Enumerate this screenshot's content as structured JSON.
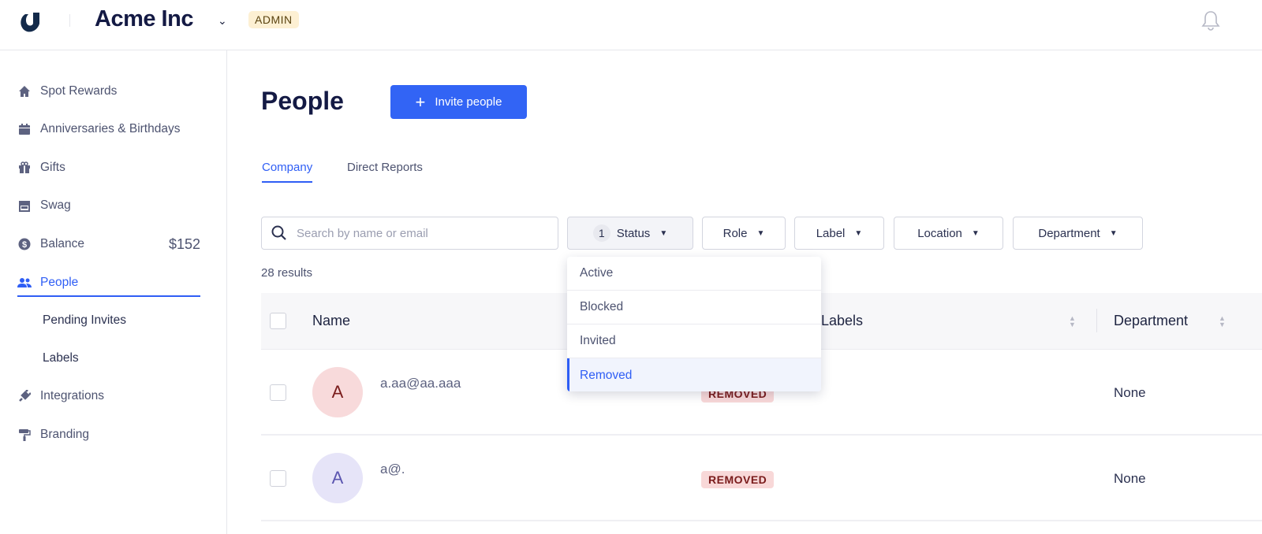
{
  "header": {
    "company": "Acme Inc",
    "role_badge": "ADMIN"
  },
  "sidebar": {
    "items": [
      {
        "label": "Spot Rewards",
        "icon": "home-icon"
      },
      {
        "label": "Anniversaries & Birthdays",
        "icon": "calendar-icon"
      },
      {
        "label": "Gifts",
        "icon": "gift-icon"
      },
      {
        "label": "Swag",
        "icon": "store-icon"
      },
      {
        "label": "Balance",
        "icon": "dollar-icon",
        "amount": "$152"
      },
      {
        "label": "People",
        "icon": "people-icon",
        "active": true
      },
      {
        "label": "Pending Invites"
      },
      {
        "label": "Labels"
      },
      {
        "label": "Integrations",
        "icon": "plug-icon"
      },
      {
        "label": "Branding",
        "icon": "paint-roller-icon"
      }
    ]
  },
  "main": {
    "title": "People",
    "invite_label": "Invite people",
    "tabs": [
      {
        "label": "Company",
        "active": true
      },
      {
        "label": "Direct Reports"
      }
    ],
    "search": {
      "placeholder": "Search by name or email",
      "value": ""
    },
    "filters": [
      {
        "label": "Status",
        "count": "1"
      },
      {
        "label": "Role"
      },
      {
        "label": "Label"
      },
      {
        "label": "Location"
      },
      {
        "label": "Department"
      }
    ],
    "status_options": [
      {
        "label": "Active"
      },
      {
        "label": "Blocked"
      },
      {
        "label": "Invited"
      },
      {
        "label": "Removed",
        "selected": true
      }
    ],
    "results": "28 results",
    "columns": [
      "Name",
      "Labels",
      "Department"
    ],
    "rows": [
      {
        "initial": "A",
        "email": "a.aa@aa.aaa",
        "status": "REMOVED",
        "department": "None",
        "avatar_bg": "#f8dadb",
        "avatar_fg": "#7a1c1c"
      },
      {
        "initial": "A",
        "email": "a@.",
        "status": "REMOVED",
        "department": "None",
        "avatar_bg": "#e6e4f8",
        "avatar_fg": "#5b55b0"
      }
    ]
  },
  "colors": {
    "accent": "#3264f5",
    "brand": "#141a44",
    "badge_removed": "#f8d8d8"
  }
}
